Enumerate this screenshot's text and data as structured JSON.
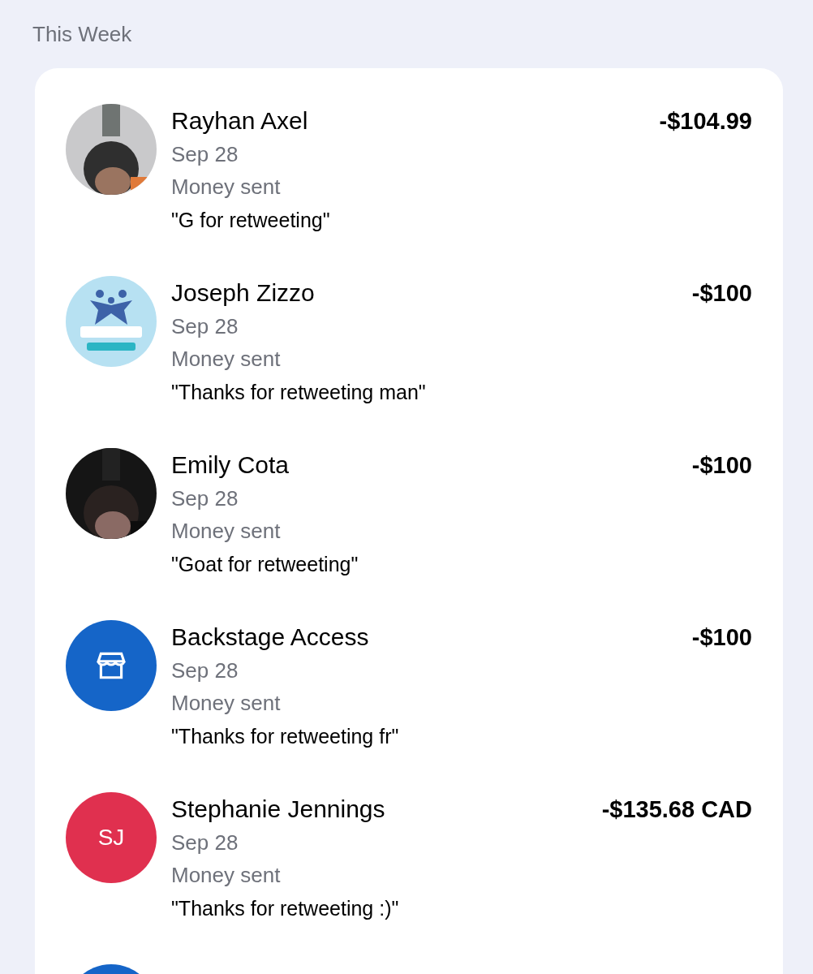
{
  "section_title": "This Week",
  "transactions": [
    {
      "name": "Rayhan Axel",
      "amount": "-$104.99",
      "date": "Sep 28",
      "status": "Money sent",
      "memo": "\"G for retweeting\""
    },
    {
      "kind": "logo",
      "name": "Joseph Zizzo",
      "amount": "-$100",
      "date": "Sep 28",
      "status": "Money sent",
      "memo": "\"Thanks for retweeting man\""
    },
    {
      "name": "Emily Cota",
      "amount": "-$100",
      "date": "Sep 28",
      "status": "Money sent",
      "memo": "\"Goat for retweeting\""
    },
    {
      "kind": "store",
      "name": "Backstage Access",
      "amount": "-$100",
      "date": "Sep 28",
      "status": "Money sent",
      "memo": "\"Thanks for retweeting fr\""
    },
    {
      "kind": "initials",
      "initials": "SJ",
      "name": "Stephanie Jennings",
      "amount": "-$135.68 CAD",
      "date": "Sep 28",
      "status": "Money sent",
      "memo": "\"Thanks for retweeting :)\""
    },
    {
      "kind": "partial"
    }
  ]
}
